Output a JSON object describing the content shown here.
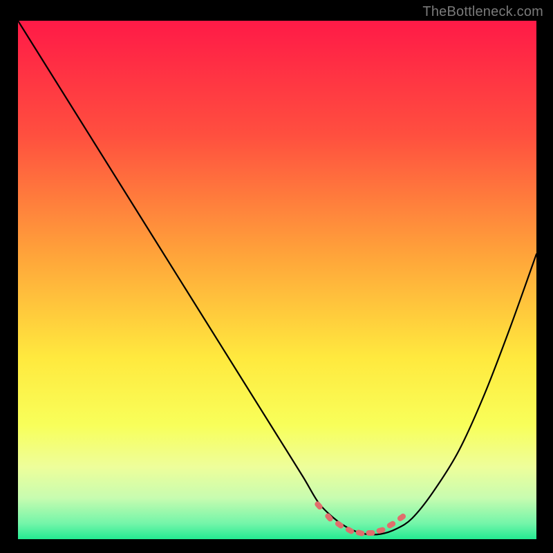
{
  "watermark": "TheBottleneck.com",
  "chart_data": {
    "type": "line",
    "title": "",
    "xlabel": "",
    "ylabel": "",
    "xlim": [
      0,
      100
    ],
    "ylim": [
      0,
      100
    ],
    "grid": false,
    "background_gradient": {
      "stops": [
        {
          "pct": 0,
          "color": "#ff1a47"
        },
        {
          "pct": 22,
          "color": "#ff4f3f"
        },
        {
          "pct": 45,
          "color": "#ffa33a"
        },
        {
          "pct": 65,
          "color": "#ffe93e"
        },
        {
          "pct": 78,
          "color": "#f8ff5a"
        },
        {
          "pct": 86,
          "color": "#eefe9a"
        },
        {
          "pct": 92,
          "color": "#c8fcb0"
        },
        {
          "pct": 97,
          "color": "#73f5a9"
        },
        {
          "pct": 100,
          "color": "#23eb92"
        }
      ]
    },
    "series": [
      {
        "name": "bottleneck-curve",
        "color": "#000000",
        "x": [
          0,
          5,
          10,
          15,
          20,
          25,
          30,
          35,
          40,
          45,
          50,
          55,
          58,
          61,
          64,
          67,
          70,
          73,
          76,
          80,
          85,
          90,
          95,
          100
        ],
        "y": [
          100,
          92,
          84,
          76,
          68,
          60,
          52,
          44,
          36,
          28,
          20,
          12,
          7,
          4,
          2,
          1,
          1,
          2,
          4,
          9,
          17,
          28,
          41,
          55
        ]
      }
    ],
    "highlight_marks": {
      "name": "optimal-range-marks",
      "color": "#e06e6c",
      "x": [
        58,
        60,
        62,
        64,
        66,
        68,
        70,
        72,
        74
      ],
      "y": [
        6.5,
        4.2,
        2.8,
        1.7,
        1.2,
        1.2,
        1.7,
        2.8,
        4.2
      ]
    }
  }
}
